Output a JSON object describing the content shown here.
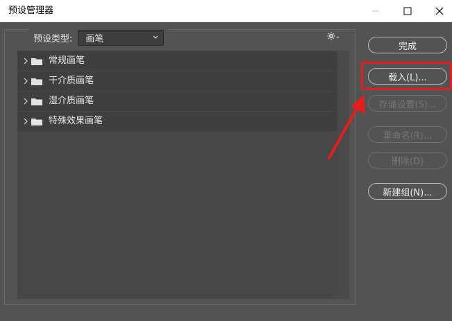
{
  "window": {
    "title": "预设管理器"
  },
  "preset_type": {
    "label": "预设类型:",
    "selected": "画笔"
  },
  "list": {
    "items": [
      {
        "label": "常规画笔"
      },
      {
        "label": "干介质画笔"
      },
      {
        "label": "湿介质画笔"
      },
      {
        "label": "特殊效果画笔"
      }
    ]
  },
  "buttons": {
    "done": "完成",
    "load": "载入(L)...",
    "save": "存储设置(S)...",
    "rename": "重命名(R)...",
    "delete": "删除(D)",
    "new_group": "新建组(N)..."
  },
  "icons": {
    "gear": "gear-icon",
    "folder": "folder-icon",
    "arrow": "chevron-right-icon"
  },
  "colors": {
    "panel_bg": "#535353",
    "row_bg": "#3f3f3f",
    "highlight": "#e81c1c"
  }
}
